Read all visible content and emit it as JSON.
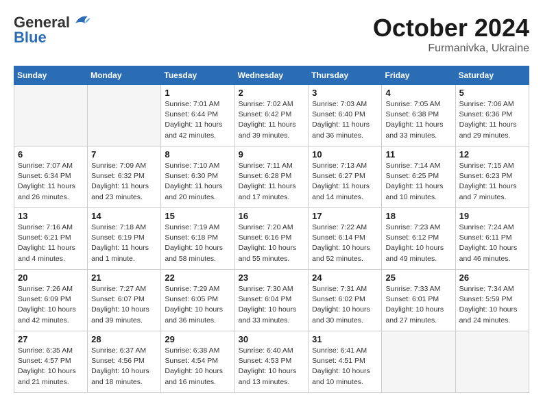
{
  "header": {
    "logo_general": "General",
    "logo_blue": "Blue",
    "month_year": "October 2024",
    "location": "Furmanivka, Ukraine"
  },
  "days_of_week": [
    "Sunday",
    "Monday",
    "Tuesday",
    "Wednesday",
    "Thursday",
    "Friday",
    "Saturday"
  ],
  "weeks": [
    [
      {
        "day": "",
        "empty": true
      },
      {
        "day": "",
        "empty": true
      },
      {
        "day": "1",
        "sunrise": "Sunrise: 7:01 AM",
        "sunset": "Sunset: 6:44 PM",
        "daylight": "Daylight: 11 hours and 42 minutes."
      },
      {
        "day": "2",
        "sunrise": "Sunrise: 7:02 AM",
        "sunset": "Sunset: 6:42 PM",
        "daylight": "Daylight: 11 hours and 39 minutes."
      },
      {
        "day": "3",
        "sunrise": "Sunrise: 7:03 AM",
        "sunset": "Sunset: 6:40 PM",
        "daylight": "Daylight: 11 hours and 36 minutes."
      },
      {
        "day": "4",
        "sunrise": "Sunrise: 7:05 AM",
        "sunset": "Sunset: 6:38 PM",
        "daylight": "Daylight: 11 hours and 33 minutes."
      },
      {
        "day": "5",
        "sunrise": "Sunrise: 7:06 AM",
        "sunset": "Sunset: 6:36 PM",
        "daylight": "Daylight: 11 hours and 29 minutes."
      }
    ],
    [
      {
        "day": "6",
        "sunrise": "Sunrise: 7:07 AM",
        "sunset": "Sunset: 6:34 PM",
        "daylight": "Daylight: 11 hours and 26 minutes."
      },
      {
        "day": "7",
        "sunrise": "Sunrise: 7:09 AM",
        "sunset": "Sunset: 6:32 PM",
        "daylight": "Daylight: 11 hours and 23 minutes."
      },
      {
        "day": "8",
        "sunrise": "Sunrise: 7:10 AM",
        "sunset": "Sunset: 6:30 PM",
        "daylight": "Daylight: 11 hours and 20 minutes."
      },
      {
        "day": "9",
        "sunrise": "Sunrise: 7:11 AM",
        "sunset": "Sunset: 6:28 PM",
        "daylight": "Daylight: 11 hours and 17 minutes."
      },
      {
        "day": "10",
        "sunrise": "Sunrise: 7:13 AM",
        "sunset": "Sunset: 6:27 PM",
        "daylight": "Daylight: 11 hours and 14 minutes."
      },
      {
        "day": "11",
        "sunrise": "Sunrise: 7:14 AM",
        "sunset": "Sunset: 6:25 PM",
        "daylight": "Daylight: 11 hours and 10 minutes."
      },
      {
        "day": "12",
        "sunrise": "Sunrise: 7:15 AM",
        "sunset": "Sunset: 6:23 PM",
        "daylight": "Daylight: 11 hours and 7 minutes."
      }
    ],
    [
      {
        "day": "13",
        "sunrise": "Sunrise: 7:16 AM",
        "sunset": "Sunset: 6:21 PM",
        "daylight": "Daylight: 11 hours and 4 minutes."
      },
      {
        "day": "14",
        "sunrise": "Sunrise: 7:18 AM",
        "sunset": "Sunset: 6:19 PM",
        "daylight": "Daylight: 11 hours and 1 minute."
      },
      {
        "day": "15",
        "sunrise": "Sunrise: 7:19 AM",
        "sunset": "Sunset: 6:18 PM",
        "daylight": "Daylight: 10 hours and 58 minutes."
      },
      {
        "day": "16",
        "sunrise": "Sunrise: 7:20 AM",
        "sunset": "Sunset: 6:16 PM",
        "daylight": "Daylight: 10 hours and 55 minutes."
      },
      {
        "day": "17",
        "sunrise": "Sunrise: 7:22 AM",
        "sunset": "Sunset: 6:14 PM",
        "daylight": "Daylight: 10 hours and 52 minutes."
      },
      {
        "day": "18",
        "sunrise": "Sunrise: 7:23 AM",
        "sunset": "Sunset: 6:12 PM",
        "daylight": "Daylight: 10 hours and 49 minutes."
      },
      {
        "day": "19",
        "sunrise": "Sunrise: 7:24 AM",
        "sunset": "Sunset: 6:11 PM",
        "daylight": "Daylight: 10 hours and 46 minutes."
      }
    ],
    [
      {
        "day": "20",
        "sunrise": "Sunrise: 7:26 AM",
        "sunset": "Sunset: 6:09 PM",
        "daylight": "Daylight: 10 hours and 42 minutes."
      },
      {
        "day": "21",
        "sunrise": "Sunrise: 7:27 AM",
        "sunset": "Sunset: 6:07 PM",
        "daylight": "Daylight: 10 hours and 39 minutes."
      },
      {
        "day": "22",
        "sunrise": "Sunrise: 7:29 AM",
        "sunset": "Sunset: 6:05 PM",
        "daylight": "Daylight: 10 hours and 36 minutes."
      },
      {
        "day": "23",
        "sunrise": "Sunrise: 7:30 AM",
        "sunset": "Sunset: 6:04 PM",
        "daylight": "Daylight: 10 hours and 33 minutes."
      },
      {
        "day": "24",
        "sunrise": "Sunrise: 7:31 AM",
        "sunset": "Sunset: 6:02 PM",
        "daylight": "Daylight: 10 hours and 30 minutes."
      },
      {
        "day": "25",
        "sunrise": "Sunrise: 7:33 AM",
        "sunset": "Sunset: 6:01 PM",
        "daylight": "Daylight: 10 hours and 27 minutes."
      },
      {
        "day": "26",
        "sunrise": "Sunrise: 7:34 AM",
        "sunset": "Sunset: 5:59 PM",
        "daylight": "Daylight: 10 hours and 24 minutes."
      }
    ],
    [
      {
        "day": "27",
        "sunrise": "Sunrise: 6:35 AM",
        "sunset": "Sunset: 4:57 PM",
        "daylight": "Daylight: 10 hours and 21 minutes."
      },
      {
        "day": "28",
        "sunrise": "Sunrise: 6:37 AM",
        "sunset": "Sunset: 4:56 PM",
        "daylight": "Daylight: 10 hours and 18 minutes."
      },
      {
        "day": "29",
        "sunrise": "Sunrise: 6:38 AM",
        "sunset": "Sunset: 4:54 PM",
        "daylight": "Daylight: 10 hours and 16 minutes."
      },
      {
        "day": "30",
        "sunrise": "Sunrise: 6:40 AM",
        "sunset": "Sunset: 4:53 PM",
        "daylight": "Daylight: 10 hours and 13 minutes."
      },
      {
        "day": "31",
        "sunrise": "Sunrise: 6:41 AM",
        "sunset": "Sunset: 4:51 PM",
        "daylight": "Daylight: 10 hours and 10 minutes."
      },
      {
        "day": "",
        "empty": true
      },
      {
        "day": "",
        "empty": true
      }
    ]
  ]
}
